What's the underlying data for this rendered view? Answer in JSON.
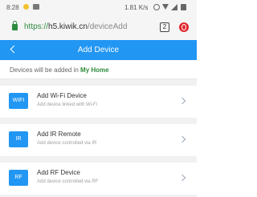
{
  "status_bar": {
    "time": "8:28",
    "speed": "1.81 K/s"
  },
  "browser": {
    "url_scheme": "https://",
    "url_host": "h5.kiwik.cn",
    "url_path": "/deviceAdd",
    "tab_count": "2"
  },
  "header": {
    "title": "Add Device"
  },
  "notice": {
    "prefix": "Devices will be added in ",
    "home_name": "My Home"
  },
  "devices": [
    {
      "icon_text": "WIFI",
      "name": "Add Wi-Fi Device",
      "description": "Add device linked with Wi-Fi"
    },
    {
      "icon_text": "IR",
      "name": "Add IR Remote",
      "description": "Add device controlled via IR"
    },
    {
      "icon_text": "RF",
      "name": "Add RF Device",
      "description": "Add device controlled via RF"
    }
  ],
  "colors": {
    "primary": "#2196f3",
    "accent_green": "#2e8b3d",
    "background": "#f1f1f1"
  },
  "icons": [
    "sun-icon",
    "image-icon",
    "alarm-icon",
    "wifi-icon",
    "signal-icon",
    "battery-icon",
    "lock-icon",
    "tabs-icon",
    "opera-icon",
    "back-icon",
    "chevron-right-icon"
  ]
}
